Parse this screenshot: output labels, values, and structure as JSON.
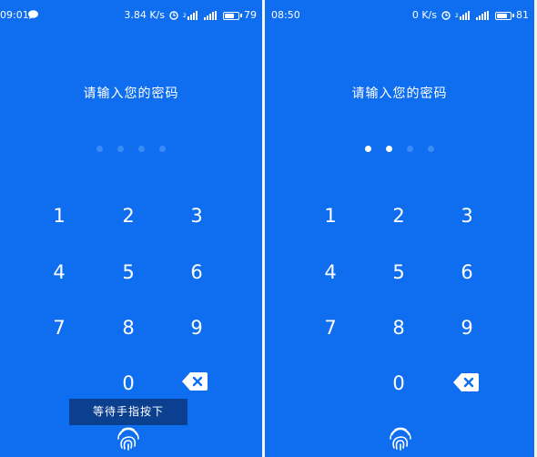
{
  "left_screen": {
    "status": {
      "time": "09:01",
      "speed": "3.84 K/s",
      "battery": "79",
      "battery_level": 0.79
    },
    "prompt": "请输入您的密码",
    "pin_total": 4,
    "pin_entered": 0,
    "keys": [
      "1",
      "2",
      "3",
      "4",
      "5",
      "6",
      "7",
      "8",
      "9",
      "0"
    ],
    "toast": "等待手指按下"
  },
  "right_screen": {
    "status": {
      "time": "08:50",
      "speed": "0 K/s",
      "battery": "81",
      "battery_level": 0.81
    },
    "prompt": "请输入您的密码",
    "pin_total": 4,
    "pin_entered": 2,
    "keys": [
      "1",
      "2",
      "3",
      "4",
      "5",
      "6",
      "7",
      "8",
      "9",
      "0"
    ]
  },
  "colors": {
    "background": "#0f6ef0",
    "toast_background": "#0b3f90",
    "dot_empty": "#3a8bf5",
    "dot_filled": "#ffffff"
  },
  "icons": {
    "status_message": "chat-bubble-icon",
    "status_alarm": "alarm-clock-icon",
    "status_signal": "signal-bars-icon",
    "status_battery": "battery-icon",
    "delete": "backspace-icon",
    "fingerprint": "fingerprint-icon"
  }
}
